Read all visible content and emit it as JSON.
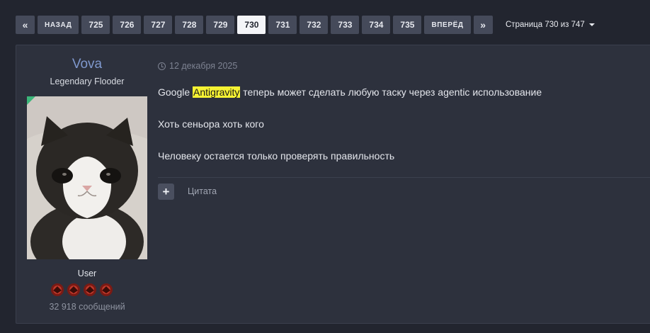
{
  "pagination": {
    "first_icon": "double-chevron-left-icon",
    "first_glyph": "«",
    "prev_label": "НАЗАД",
    "pages": [
      "725",
      "726",
      "727",
      "728",
      "729",
      "730",
      "731",
      "732",
      "733",
      "734",
      "735"
    ],
    "current_page": "730",
    "next_label": "ВПЕРЁД",
    "last_icon": "double-chevron-right-icon",
    "last_glyph": "»",
    "page_selector_label": "Страница 730 из 747"
  },
  "post": {
    "author": {
      "username": "Vova",
      "title": "Legendary Flooder",
      "group": "User",
      "reputation_icons": 4,
      "message_count": "32 918 сообщений"
    },
    "date": "12 декабря 2025",
    "lines": [
      {
        "before": "Google ",
        "highlight": "Antigravity",
        "after": " теперь может сделать любую таску через agentic использование"
      },
      {
        "text": "Хоть сеньора хоть кого"
      },
      {
        "text": "Человеку остается только проверять правильность"
      }
    ],
    "actions": {
      "multiquote_glyph": "+",
      "quote_label": "Цитата"
    }
  },
  "colors": {
    "background": "#22252f",
    "post_bg": "#2d313d",
    "username": "#7f98cd",
    "highlight": "#f6f233",
    "online": "#3bb67a"
  }
}
